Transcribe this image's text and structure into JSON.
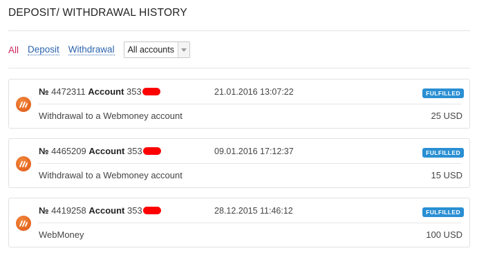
{
  "page": {
    "title": "DEPOSIT/ WITHDRAWAL HISTORY"
  },
  "filters": {
    "all": "All",
    "deposit": "Deposit",
    "withdrawal": "Withdrawal",
    "account_select": {
      "selected": "All accounts"
    }
  },
  "colors": {
    "accent": "#c8275f",
    "link": "#2c64ae",
    "badge": "#2a8fd3",
    "icon": "#e46520"
  },
  "transactions": [
    {
      "number_sign": "№",
      "number": "4472311",
      "account_label": "Account",
      "account_prefix": "353",
      "date": "21.01.2016 13:07:22",
      "status": "FULFILLED",
      "description": "Withdrawal to a Webmoney account",
      "amount": "25 USD",
      "icon": "payment-system-icon"
    },
    {
      "number_sign": "№",
      "number": "4465209",
      "account_label": "Account",
      "account_prefix": "353",
      "date": "09.01.2016 17:12:37",
      "status": "FULFILLED",
      "description": "Withdrawal to a Webmoney account",
      "amount": "15 USD",
      "icon": "payment-system-icon"
    },
    {
      "number_sign": "№",
      "number": "4419258",
      "account_label": "Account",
      "account_prefix": "353",
      "date": "28.12.2015 11:46:12",
      "status": "FULFILLED",
      "description": "WebMoney",
      "amount": "100 USD",
      "icon": "payment-system-icon"
    }
  ]
}
